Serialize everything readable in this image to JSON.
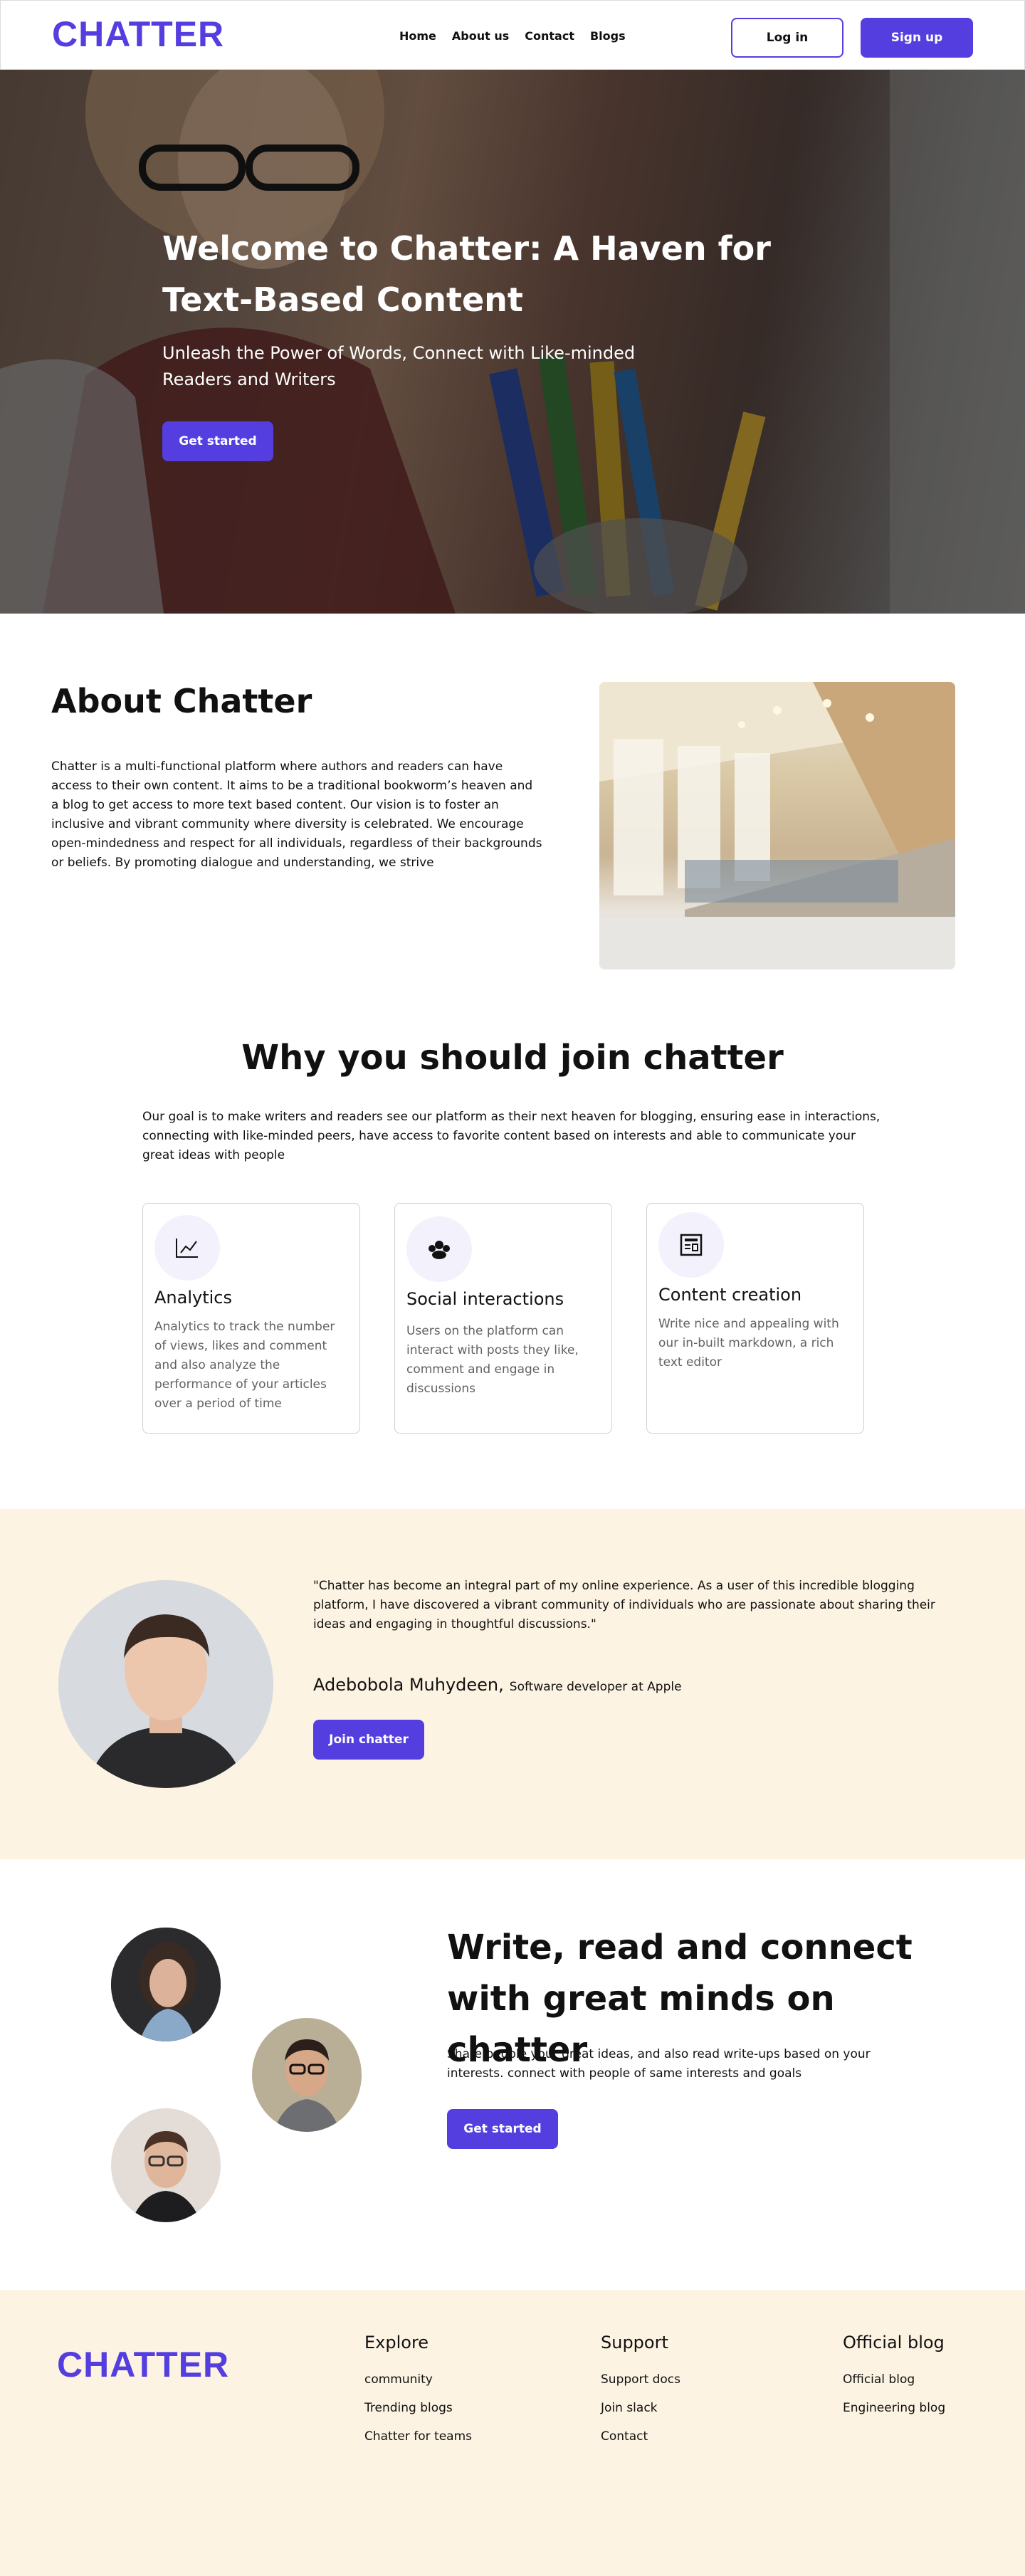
{
  "nav": {
    "logo": "CHATTER",
    "links": [
      "Home",
      "About us",
      "Contact",
      "Blogs"
    ],
    "login": "Log in",
    "signup": "Sign up"
  },
  "hero": {
    "title": "Welcome to Chatter: A Haven for Text-Based Content",
    "subtitle": "Unleash the Power of Words, Connect with Like-minded Readers and Writers",
    "cta": "Get started"
  },
  "about": {
    "title": "About Chatter",
    "text": "Chatter is a multi-functional platform where authors and readers can have access to their own content. It aims to be a traditional bookworm’s heaven and a blog to get access to more text based content. Our vision is to foster an inclusive and vibrant community where diversity is celebrated. We encourage open-mindedness and respect for all individuals, regardless of their backgrounds or beliefs. By promoting dialogue and understanding, we strive"
  },
  "why": {
    "title": "Why you should join chatter",
    "text": "Our goal is to make writers and readers see our platform as their next heaven for blogging, ensuring ease in interactions, connecting with like-minded peers, have access to favorite content based on interests and able to communicate your great ideas with people",
    "cards": [
      {
        "icon": "analytics-chart-icon",
        "title": "Analytics",
        "text": "Analytics to track the number of views, likes and comment and also analyze the performance of your articles over a period of time"
      },
      {
        "icon": "social-group-icon",
        "title": "Social interactions",
        "text": "Users on the platform can interact with posts they like, comment and engage in discussions"
      },
      {
        "icon": "content-document-icon",
        "title": "Content creation",
        "text": "Write nice and appealing with our in-built markdown, a rich text editor"
      }
    ]
  },
  "testimonial": {
    "quote": "\"Chatter has become an integral part of my online experience. As a user of this incredible blogging platform, I have discovered a vibrant community of individuals who are passionate about sharing their ideas and engaging in thoughtful discussions.\"",
    "name": "Adebobola Muhydeen,",
    "role": "Software developer at Apple",
    "cta": "Join chatter"
  },
  "connect": {
    "title": "Write, read and connect with great minds on chatter",
    "text": "Share people your great ideas, and also read write-ups based on your interests. connect with people of same interests and goals",
    "cta": "Get started"
  },
  "footer": {
    "logo": "CHATTER",
    "columns": [
      {
        "title": "Explore",
        "links": [
          "community",
          "Trending blogs",
          "Chatter for teams"
        ]
      },
      {
        "title": "Support",
        "links": [
          "Support docs",
          "Join slack",
          "Contact"
        ]
      },
      {
        "title": "Official blog",
        "links": [
          "Official blog",
          "Engineering blog"
        ]
      }
    ]
  },
  "colors": {
    "brand": "#543ee0",
    "cream": "#fdf3e2",
    "text_muted": "#626262"
  }
}
